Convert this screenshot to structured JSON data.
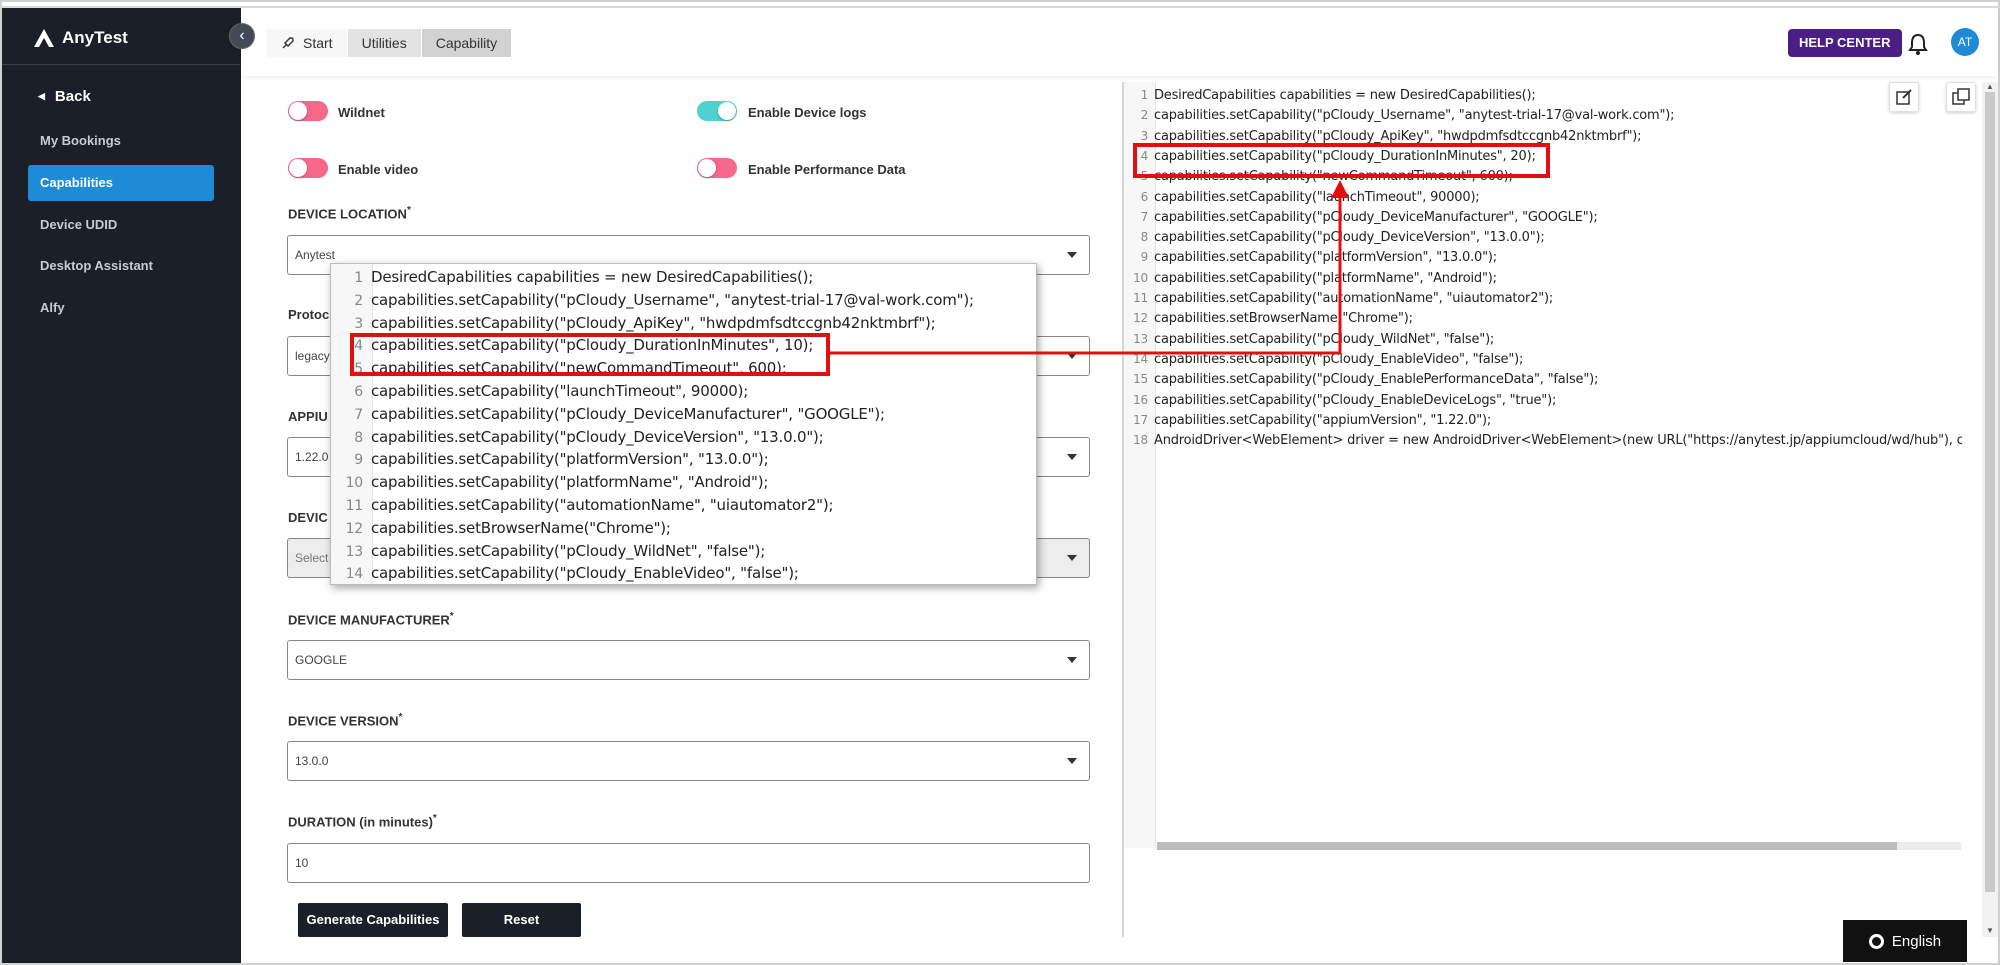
{
  "app": {
    "logo_text": "AnyTest"
  },
  "sidebar": {
    "back_label": "Back",
    "items": [
      {
        "label": "My Bookings"
      },
      {
        "label": "Capabilities"
      },
      {
        "label": "Device UDID"
      },
      {
        "label": "Desktop Assistant"
      },
      {
        "label": "Alfy"
      }
    ]
  },
  "header": {
    "breadcrumbs": [
      "Start",
      "Utilities",
      "Capability"
    ],
    "help_label": "HELP CENTER",
    "avatar_initials": "AT"
  },
  "form": {
    "toggles": [
      {
        "label": "Wildnet",
        "on": false
      },
      {
        "label": "Enable Device logs",
        "on": true
      },
      {
        "label": "Enable video",
        "on": false
      },
      {
        "label": "Enable Performance Data",
        "on": false
      }
    ],
    "device_location": {
      "label": "DEVICE LOCATION",
      "value": "Anytest"
    },
    "protocol": {
      "label": "Protoc",
      "value": "legacy"
    },
    "appium": {
      "label": "APPIU",
      "value": "1.22.0"
    },
    "device": {
      "label": "DEVIC",
      "value": "Select"
    },
    "device_manufacturer": {
      "label": "DEVICE MANUFACTURER",
      "value": "GOOGLE"
    },
    "device_version": {
      "label": "DEVICE VERSION",
      "value": "13.0.0"
    },
    "duration": {
      "label": "DURATION (in minutes)",
      "value": "10"
    },
    "required_mark": "*",
    "generate_label": "Generate Capabilities",
    "reset_label": "Reset"
  },
  "code_panel": {
    "lines": [
      "DesiredCapabilities capabilities = new DesiredCapabilities();",
      "capabilities.setCapability(\"pCloudy_Username\", \"anytest-trial-17@val-work.com\");",
      "capabilities.setCapability(\"pCloudy_ApiKey\", \"hwdpdmfsdtccgnb42nktmbrf\");",
      "capabilities.setCapability(\"pCloudy_DurationInMinutes\", 20);",
      "capabilities.setCapability(\"newCommandTimeout\", 600);",
      "capabilities.setCapability(\"launchTimeout\", 90000);",
      "capabilities.setCapability(\"pCloudy_DeviceManufacturer\", \"GOOGLE\");",
      "capabilities.setCapability(\"pCloudy_DeviceVersion\", \"13.0.0\");",
      "capabilities.setCapability(\"platformVersion\", \"13.0.0\");",
      "capabilities.setCapability(\"platformName\", \"Android\");",
      "capabilities.setCapability(\"automationName\", \"uiautomator2\");",
      "capabilities.setBrowserName(\"Chrome\");",
      "capabilities.setCapability(\"pCloudy_WildNet\", \"false\");",
      "capabilities.setCapability(\"pCloudy_EnableVideo\", \"false\");",
      "capabilities.setCapability(\"pCloudy_EnablePerformanceData\", \"false\");",
      "capabilities.setCapability(\"pCloudy_EnableDeviceLogs\", \"true\");",
      "capabilities.setCapability(\"appiumVersion\", \"1.22.0\");",
      "AndroidDriver<WebElement> driver = new AndroidDriver<WebElement>(new URL(\"https://anytest.jp/appiumcloud/wd/hub\"), ca"
    ]
  },
  "popup": {
    "lines": [
      "DesiredCapabilities capabilities = new DesiredCapabilities();",
      "capabilities.setCapability(\"pCloudy_Username\", \"anytest-trial-17@val-work.com\");",
      "capabilities.setCapability(\"pCloudy_ApiKey\", \"hwdpdmfsdtccgnb42nktmbrf\");",
      "capabilities.setCapability(\"pCloudy_DurationInMinutes\", 10);",
      "capabilities.setCapability(\"newCommandTimeout\", 600);",
      "capabilities.setCapability(\"launchTimeout\", 90000);",
      "capabilities.setCapability(\"pCloudy_DeviceManufacturer\", \"GOOGLE\");",
      "capabilities.setCapability(\"pCloudy_DeviceVersion\", \"13.0.0\");",
      "capabilities.setCapability(\"platformVersion\", \"13.0.0\");",
      "capabilities.setCapability(\"platformName\", \"Android\");",
      "capabilities.setCapability(\"automationName\", \"uiautomator2\");",
      "capabilities.setBrowserName(\"Chrome\");",
      "capabilities.setCapability(\"pCloudy_WildNet\", \"false\");",
      "capabilities.setCapability(\"pCloudy_EnableVideo\", \"false\");"
    ]
  },
  "language": {
    "label": "English"
  },
  "colors": {
    "accent": "#1f8ad6",
    "help": "#4b1e86",
    "highlight": "#e01010",
    "toggle_off": "#f5688c",
    "toggle_on": "#4fd1d0"
  },
  "icons": [
    "rocket-icon",
    "bell-icon",
    "edit-icon",
    "copy-icon",
    "globe-icon",
    "chevron-left-icon"
  ]
}
